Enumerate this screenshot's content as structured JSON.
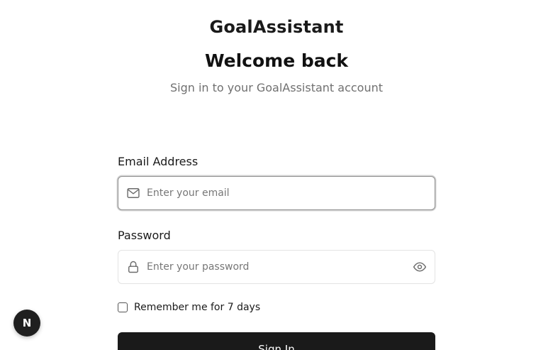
{
  "header": {
    "brand": "GoalAssistant",
    "title": "Welcome back",
    "subtitle": "Sign in to your GoalAssistant account"
  },
  "form": {
    "email": {
      "label": "Email Address",
      "value": "",
      "placeholder": "Enter your email",
      "icon": "mail-icon"
    },
    "password": {
      "label": "Password",
      "value": "",
      "placeholder": "Enter your password",
      "icon": "lock-icon",
      "toggle_icon": "eye-icon"
    },
    "remember": {
      "label": "Remember me for 7 days",
      "checked": false
    },
    "submit_label": "Sign In"
  },
  "dev_badge": {
    "letter": "N",
    "icon": "nextjs-icon"
  },
  "colors": {
    "button_bg": "#1a1a1a",
    "subtitle": "#707070",
    "placeholder": "#777777"
  }
}
